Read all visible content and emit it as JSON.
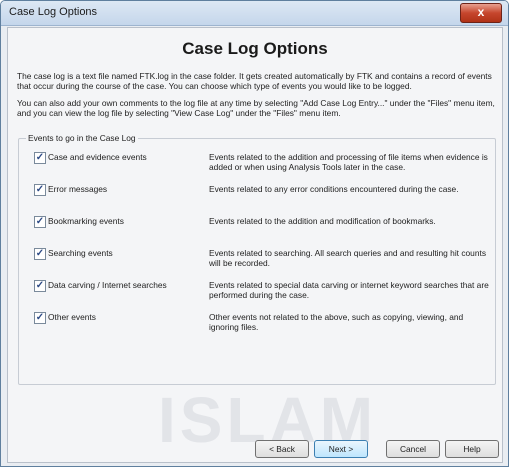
{
  "window": {
    "title": "Case Log Options",
    "close_glyph": "x"
  },
  "content": {
    "heading": "Case Log Options",
    "paragraph1": "The case log is a text file named FTK.log in the case folder. It gets created automatically by FTK and contains a record of events that occur during the course of the case. You can choose which type of events you would like to be logged.",
    "paragraph2": "You can also add your own comments to the log file at any time by selecting \"Add Case Log Entry...\" under the \"Files\" menu item, and you can view the log file by selecting \"View Case Log\" under the \"Files\" menu item."
  },
  "group": {
    "label": "Events to go in the Case Log",
    "options": [
      {
        "label": "Case and evidence events",
        "checked": true,
        "description": "Events related to the addition and processing of file items when evidence is added or when using Analysis Tools later in the case."
      },
      {
        "label": "Error messages",
        "checked": true,
        "description": "Events related to any error conditions encountered during the case."
      },
      {
        "label": "Bookmarking events",
        "checked": true,
        "description": "Events related to the addition and modification of bookmarks."
      },
      {
        "label": "Searching events",
        "checked": true,
        "description": "Events related to searching. All search queries and and resulting hit counts will be recorded."
      },
      {
        "label": "Data carving / Internet searches",
        "checked": true,
        "description": "Events related to special data carving or internet keyword searches that are performed during the case."
      },
      {
        "label": "Other events",
        "checked": true,
        "description": "Other events not related to the above, such as copying, viewing, and ignoring files."
      }
    ]
  },
  "watermark": "ISLAM",
  "buttons": {
    "back": "< Back",
    "next": "Next >",
    "cancel": "Cancel",
    "help": "Help"
  },
  "colors": {
    "close_button": "#c6462d",
    "check_mark": "#2d4a85"
  }
}
